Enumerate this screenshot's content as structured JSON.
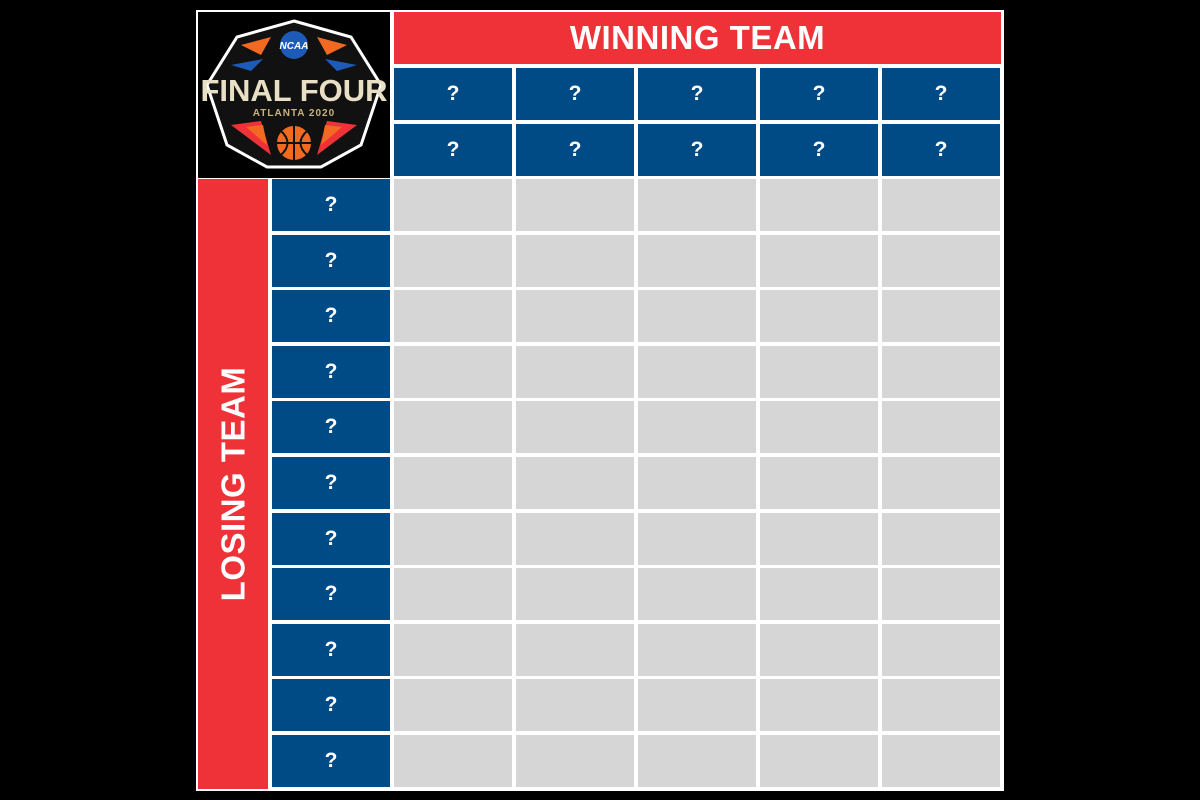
{
  "logo": {
    "org": "NCAA",
    "title": "FINAL FOUR",
    "subtitle": "ATLANTA 2020"
  },
  "headers": {
    "winning": "WINNING TEAM",
    "losing": "LOSING TEAM"
  },
  "winning_digits": {
    "row1": [
      "?",
      "?",
      "?",
      "?",
      "?"
    ],
    "row2": [
      "?",
      "?",
      "?",
      "?",
      "?"
    ]
  },
  "losing_digits": [
    "?",
    "?",
    "?",
    "?",
    "?",
    "?",
    "?",
    "?",
    "?",
    "?",
    "?"
  ],
  "grid": {
    "rows": 11,
    "cols": 5,
    "cells": [
      [
        "",
        "",
        "",
        "",
        ""
      ],
      [
        "",
        "",
        "",
        "",
        ""
      ],
      [
        "",
        "",
        "",
        "",
        ""
      ],
      [
        "",
        "",
        "",
        "",
        ""
      ],
      [
        "",
        "",
        "",
        "",
        ""
      ],
      [
        "",
        "",
        "",
        "",
        ""
      ],
      [
        "",
        "",
        "",
        "",
        ""
      ],
      [
        "",
        "",
        "",
        "",
        ""
      ],
      [
        "",
        "",
        "",
        "",
        ""
      ],
      [
        "",
        "",
        "",
        "",
        ""
      ],
      [
        "",
        "",
        "",
        "",
        ""
      ]
    ]
  },
  "colors": {
    "red": "#EE3237",
    "blue": "#004A85",
    "gray": "#D6D6D6"
  }
}
